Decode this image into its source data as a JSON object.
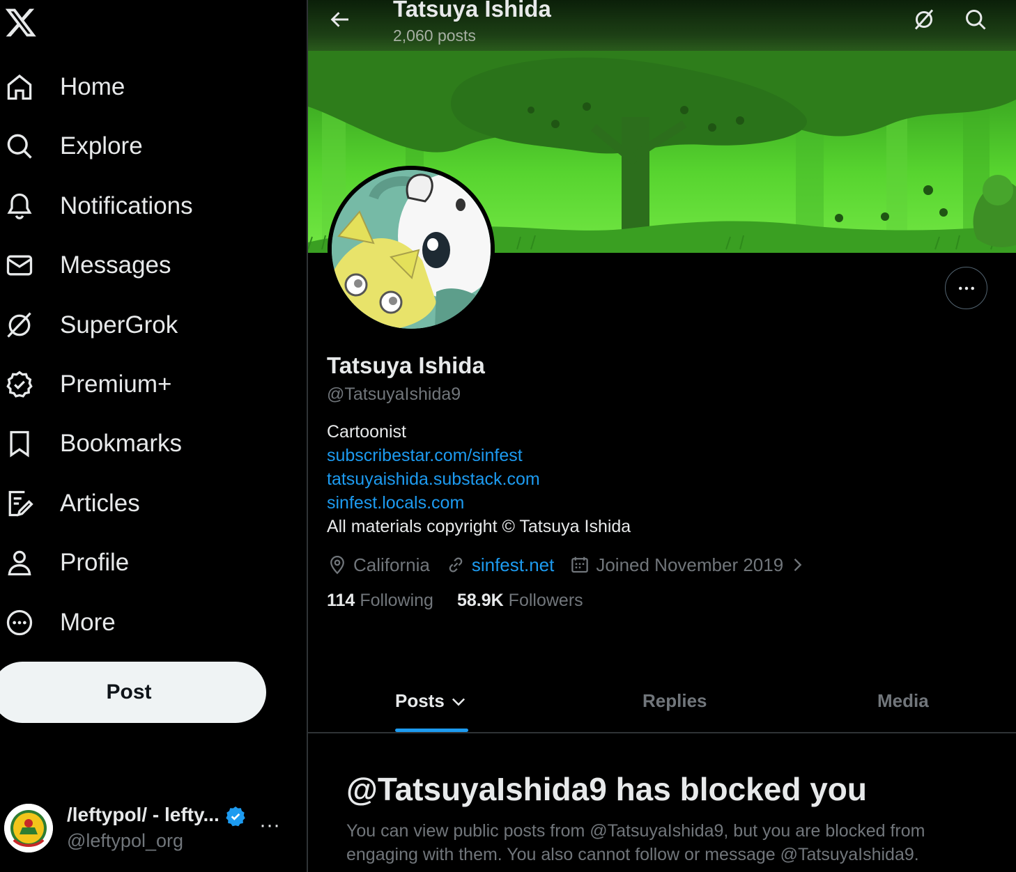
{
  "sidebar": {
    "nav": [
      {
        "label": "Home",
        "icon": "home-icon"
      },
      {
        "label": "Explore",
        "icon": "search-icon"
      },
      {
        "label": "Notifications",
        "icon": "bell-icon"
      },
      {
        "label": "Messages",
        "icon": "envelope-icon"
      },
      {
        "label": "SuperGrok",
        "icon": "grok-icon"
      },
      {
        "label": "Premium+",
        "icon": "verified-icon"
      },
      {
        "label": "Bookmarks",
        "icon": "bookmark-icon"
      },
      {
        "label": "Articles",
        "icon": "article-icon"
      },
      {
        "label": "Profile",
        "icon": "person-icon"
      },
      {
        "label": "More",
        "icon": "more-circle-icon"
      }
    ],
    "post_label": "Post",
    "account": {
      "name": "/leftypol/ - lefty...",
      "handle": "@leftypol_org",
      "more": "···"
    }
  },
  "header": {
    "title": "Tatsuya Ishida",
    "post_count": "2,060 posts"
  },
  "profile": {
    "name": "Tatsuya Ishida",
    "handle": "@TatsuyaIshida9",
    "bio": {
      "line1": "Cartoonist",
      "link1": "subscribestar.com/sinfest",
      "link2": "tatsuyaishida.substack.com",
      "link3": "sinfest.locals.com",
      "line5": "All materials copyright © Tatsuya Ishida"
    },
    "location": "California",
    "website": "sinfest.net",
    "joined": "Joined November 2019",
    "following_count": "114",
    "following_label": "Following",
    "followers_count": "58.9K",
    "followers_label": "Followers"
  },
  "tabs": {
    "posts": "Posts",
    "replies": "Replies",
    "media": "Media"
  },
  "blocked": {
    "title": "@TatsuyaIshida9 has blocked you",
    "body": "You can view public posts from @TatsuyaIshida9, but you are blocked from engaging with them. You also cannot follow or message @TatsuyaIshida9."
  },
  "colors": {
    "accent": "#1d9bf0",
    "muted": "#71767b",
    "text": "#e7e9ea",
    "banner": "#59c531"
  }
}
